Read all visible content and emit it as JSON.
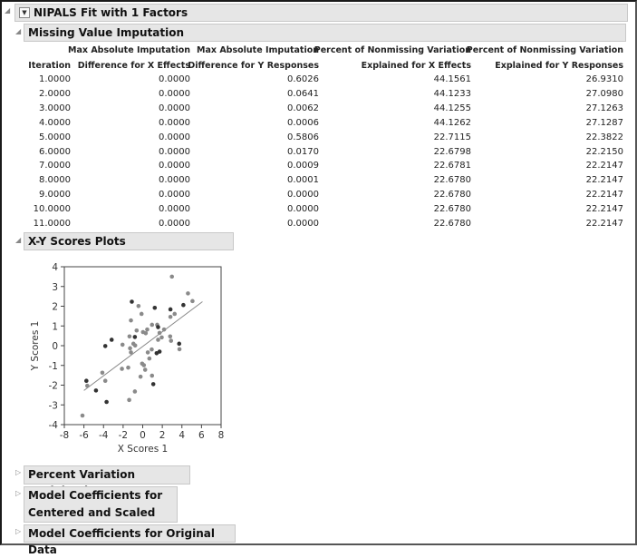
{
  "outline": {
    "title": "NIPALS Fit with 1 Factors"
  },
  "missing_value_imputation": {
    "title": "Missing Value Imputation",
    "columns": [
      [
        "",
        "Iteration"
      ],
      [
        "Max Absolute Imputation",
        "Difference for X Effects"
      ],
      [
        "Max Absolute Imputation",
        "Difference for Y Responses"
      ],
      [
        "Percent of Nonmissing Variation",
        "Explained for X Effects"
      ],
      [
        "Percent of Nonmissing Variation",
        "Explained for Y Responses"
      ]
    ],
    "rows": [
      [
        "1.0000",
        "0.0000",
        "0.6026",
        "44.1561",
        "26.9310"
      ],
      [
        "2.0000",
        "0.0000",
        "0.0641",
        "44.1233",
        "27.0980"
      ],
      [
        "3.0000",
        "0.0000",
        "0.0062",
        "44.1255",
        "27.1263"
      ],
      [
        "4.0000",
        "0.0000",
        "0.0006",
        "44.1262",
        "27.1287"
      ],
      [
        "5.0000",
        "0.0000",
        "0.5806",
        "22.7115",
        "22.3822"
      ],
      [
        "6.0000",
        "0.0000",
        "0.0170",
        "22.6798",
        "22.2150"
      ],
      [
        "7.0000",
        "0.0000",
        "0.0009",
        "22.6781",
        "22.2147"
      ],
      [
        "8.0000",
        "0.0000",
        "0.0001",
        "22.6780",
        "22.2147"
      ],
      [
        "9.0000",
        "0.0000",
        "0.0000",
        "22.6780",
        "22.2147"
      ],
      [
        "10.0000",
        "0.0000",
        "0.0000",
        "22.6780",
        "22.2147"
      ],
      [
        "11.0000",
        "0.0000",
        "0.0000",
        "22.6780",
        "22.2147"
      ]
    ]
  },
  "xy_scores": {
    "title": "X-Y Scores Plots"
  },
  "chart_data": {
    "type": "scatter",
    "xlabel": "X Scores 1",
    "ylabel": "Y Scores 1",
    "xlim": [
      -8,
      8
    ],
    "ylim": [
      -4,
      4
    ],
    "xticks": [
      "-8",
      "-6",
      "-4",
      "-2",
      "0",
      "2",
      "4",
      "6",
      "8"
    ],
    "yticks": [
      "-4",
      "-3",
      "-2",
      "-1",
      "0",
      "1",
      "2",
      "3",
      "4"
    ],
    "grid": false,
    "colors": {
      "dark": "#333333",
      "light": "#8a8a8a",
      "line": "#888888"
    },
    "fit_line": {
      "x": [
        -6.0,
        6.1
      ],
      "y": [
        -2.27,
        2.23
      ]
    },
    "points_dark": [
      [
        -5.75,
        -1.78
      ],
      [
        -4.77,
        -2.27
      ],
      [
        -3.69,
        -2.85
      ],
      [
        -3.82,
        -0.02
      ],
      [
        -3.17,
        0.3
      ],
      [
        -1.11,
        2.23
      ],
      [
        1.23,
        1.92
      ],
      [
        2.83,
        1.84
      ],
      [
        4.15,
        2.06
      ],
      [
        3.72,
        0.1
      ],
      [
        1.72,
        -0.3
      ],
      [
        1.42,
        -0.38
      ],
      [
        1.08,
        -1.95
      ],
      [
        1.57,
        0.94
      ],
      [
        -0.8,
        0.44
      ]
    ],
    "points_light": [
      [
        -6.15,
        -3.54
      ],
      [
        -5.66,
        -2.03
      ],
      [
        -4.12,
        -1.37
      ],
      [
        -3.82,
        -1.78
      ],
      [
        -2.06,
        0.05
      ],
      [
        -2.12,
        -1.17
      ],
      [
        -1.48,
        -1.11
      ],
      [
        -1.38,
        -2.75
      ],
      [
        -1.35,
        0.47
      ],
      [
        -1.29,
        -0.13
      ],
      [
        -1.2,
        -0.34
      ],
      [
        -1.2,
        1.28
      ],
      [
        -0.95,
        0.1
      ],
      [
        -0.77,
        0.01
      ],
      [
        -0.62,
        0.77
      ],
      [
        -0.43,
        2.01
      ],
      [
        -0.8,
        -2.32
      ],
      [
        -0.12,
        1.61
      ],
      [
        -0.22,
        -1.57
      ],
      [
        0.03,
        0.69
      ],
      [
        -0.06,
        -0.91
      ],
      [
        0.12,
        -0.99
      ],
      [
        0.25,
        -1.22
      ],
      [
        0.31,
        0.63
      ],
      [
        0.46,
        0.82
      ],
      [
        0.52,
        -0.34
      ],
      [
        0.68,
        -0.65
      ],
      [
        0.92,
        -0.19
      ],
      [
        0.95,
        -1.52
      ],
      [
        0.95,
        1.06
      ],
      [
        1.48,
        1.06
      ],
      [
        1.57,
        0.3
      ],
      [
        1.72,
        0.65
      ],
      [
        1.94,
        0.42
      ],
      [
        2.18,
        0.82
      ],
      [
        2.8,
        0.47
      ],
      [
        2.83,
        1.46
      ],
      [
        2.89,
        0.25
      ],
      [
        2.98,
        3.5
      ],
      [
        3.26,
        1.61
      ],
      [
        3.75,
        -0.18
      ],
      [
        4.62,
        2.65
      ],
      [
        5.08,
        2.26
      ]
    ]
  },
  "collapsed_sections": [
    "Percent Variation Explained",
    [
      "Model Coefficients for",
      "Centered and Scaled Data"
    ],
    "Model Coefficients for Original Data"
  ]
}
